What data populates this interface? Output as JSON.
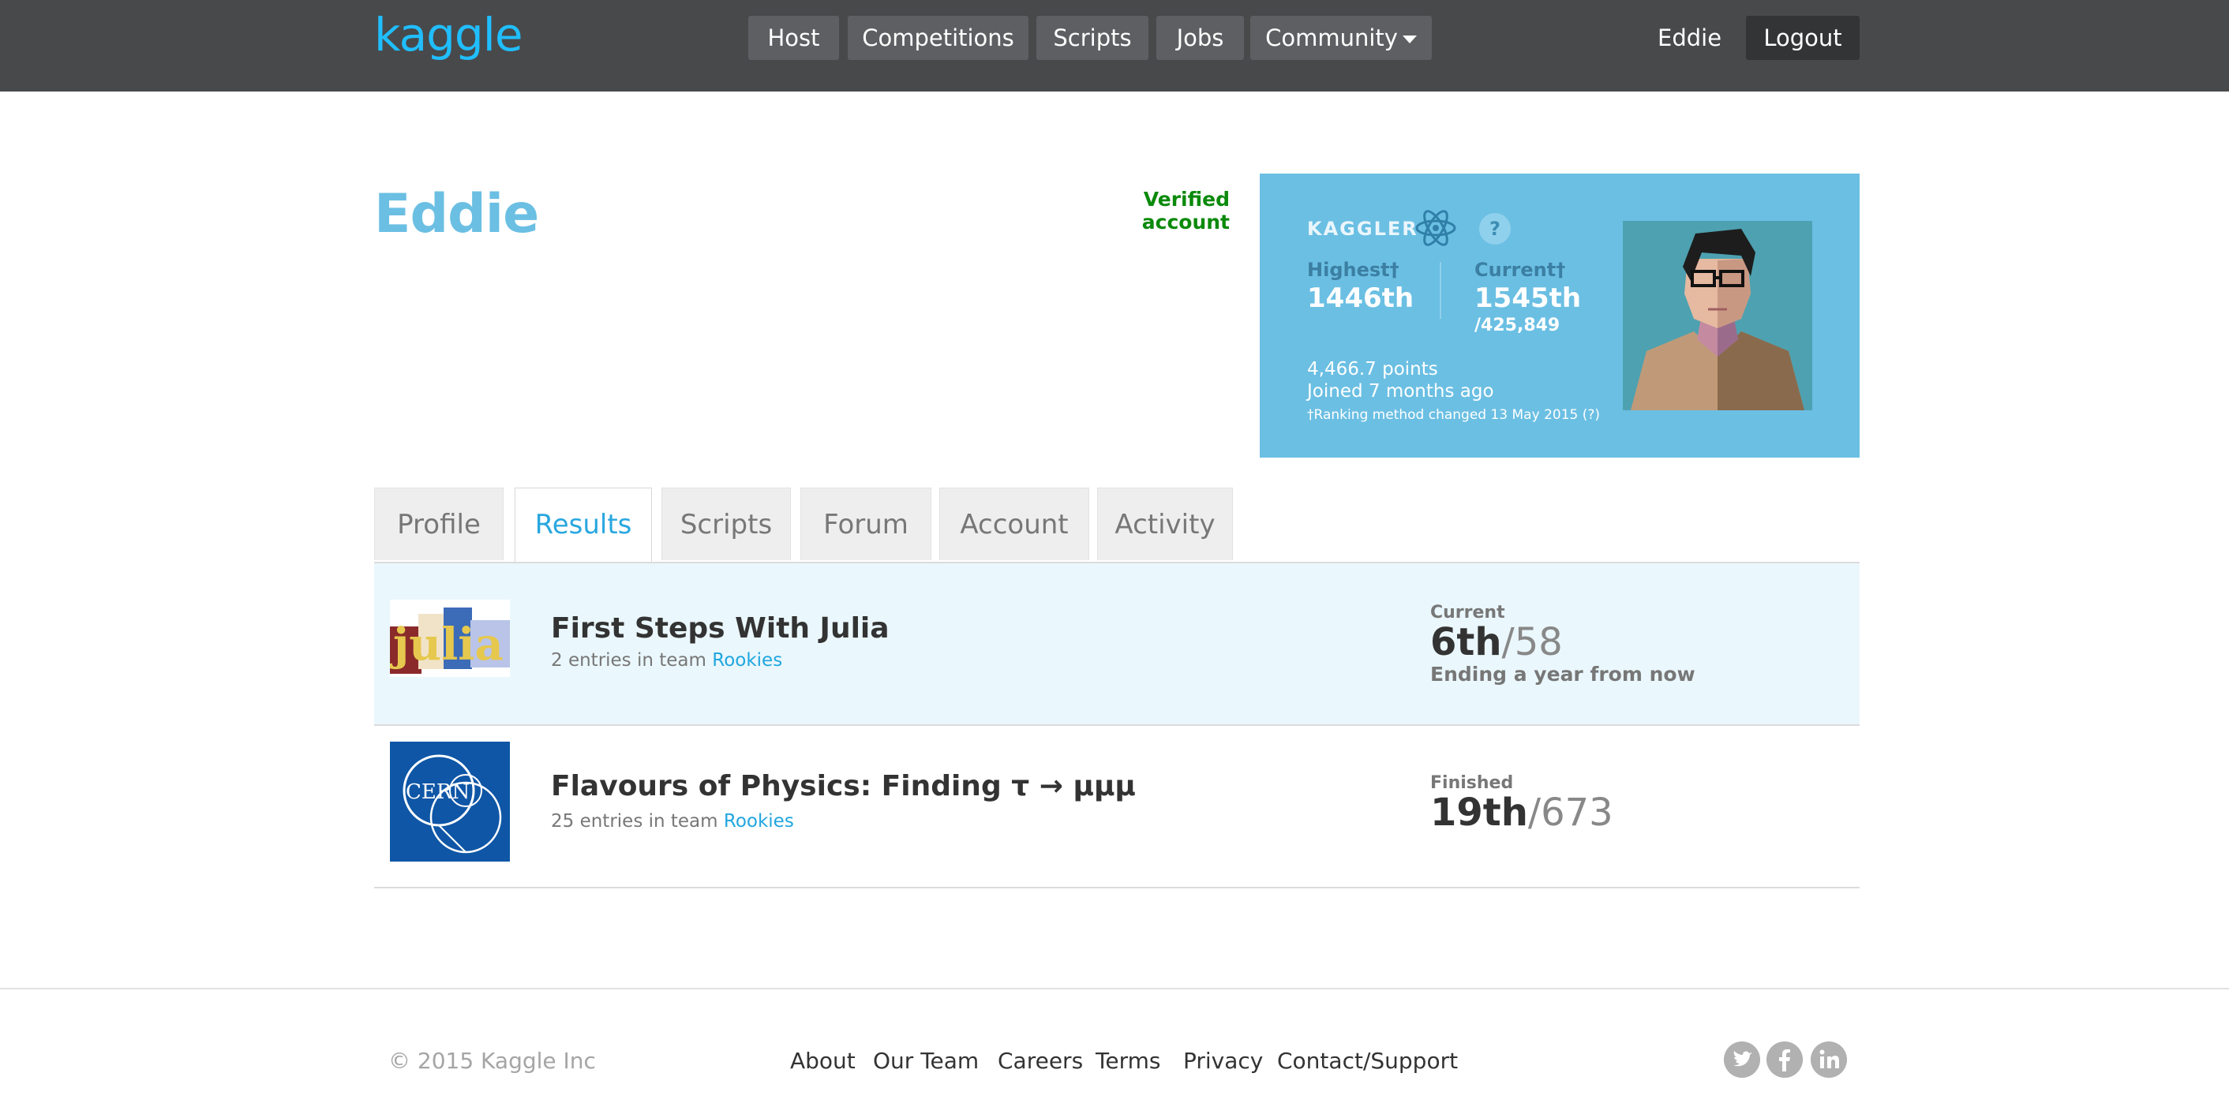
{
  "header": {
    "logo": "kaggle",
    "nav": [
      "Host",
      "Competitions",
      "Scripts",
      "Jobs",
      "Community"
    ],
    "user": "Eddie",
    "logout": "Logout"
  },
  "profile": {
    "name": "Eddie",
    "verified": "Verified account"
  },
  "card": {
    "tier": "KAGGLER",
    "help": "?",
    "highest_label": "Highest†",
    "highest_value": "1446th",
    "current_label": "Current†",
    "current_value": "1545th",
    "current_total": "/425,849",
    "points": "4,466.7 points",
    "joined": "Joined 7 months ago",
    "ranking_note": "†Ranking method changed 13 May 2015 (?)",
    "accent_color": "#6bbfe3"
  },
  "tabs": [
    "Profile",
    "Results",
    "Scripts",
    "Forum",
    "Account",
    "Activity"
  ],
  "active_tab": "Results",
  "results": [
    {
      "title": "First Steps With Julia",
      "entries_prefix": "2 entries in team",
      "team": "Rookies",
      "status": "Current",
      "rank": "6th",
      "total": "/58",
      "ending": "Ending a year from now",
      "thumb_icon": "julia-logo",
      "thumb_text": "julia"
    },
    {
      "title": "Flavours of Physics: Finding τ → μμμ",
      "entries_prefix": "25 entries in team",
      "team": "Rookies",
      "status": "Finished",
      "rank": "19th",
      "total": "/673",
      "thumb_icon": "cern-logo",
      "thumb_text": "CERN"
    }
  ],
  "footer": {
    "copyright": "© 2015 Kaggle Inc",
    "links": [
      "About",
      "Our Team",
      "Careers",
      "Terms",
      "Privacy",
      "Contact/Support"
    ],
    "social": [
      "twitter-icon",
      "facebook-icon",
      "linkedin-icon"
    ]
  }
}
